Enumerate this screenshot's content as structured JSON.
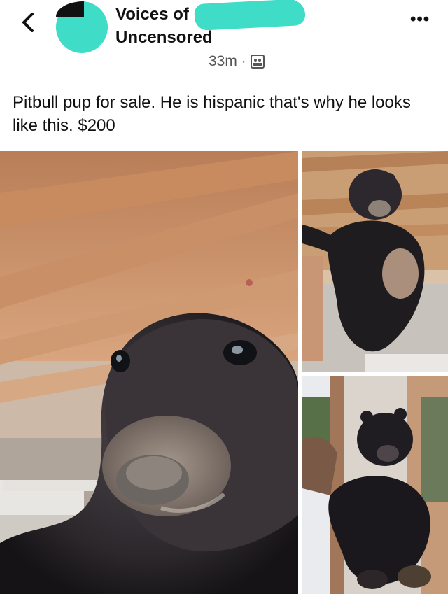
{
  "header": {
    "title_line1": "Voices of",
    "title_line2": "Uncensored",
    "timestamp": "33m ·",
    "back_icon": "chevron-left-icon",
    "more_icon": "more-dots-icon",
    "more_label": "•••",
    "audience_icon": "group-icon"
  },
  "post": {
    "caption": "Pitbull pup for sale. He is hispanic that's why he looks like this. $200"
  },
  "photos": [
    {
      "subject": "bear cub close-up"
    },
    {
      "subject": "bear cub held up under ceiling"
    },
    {
      "subject": "bear cub held on porch"
    }
  ],
  "colors": {
    "redaction": "#3fdcc8",
    "text": "#111111",
    "meta": "#555555"
  }
}
